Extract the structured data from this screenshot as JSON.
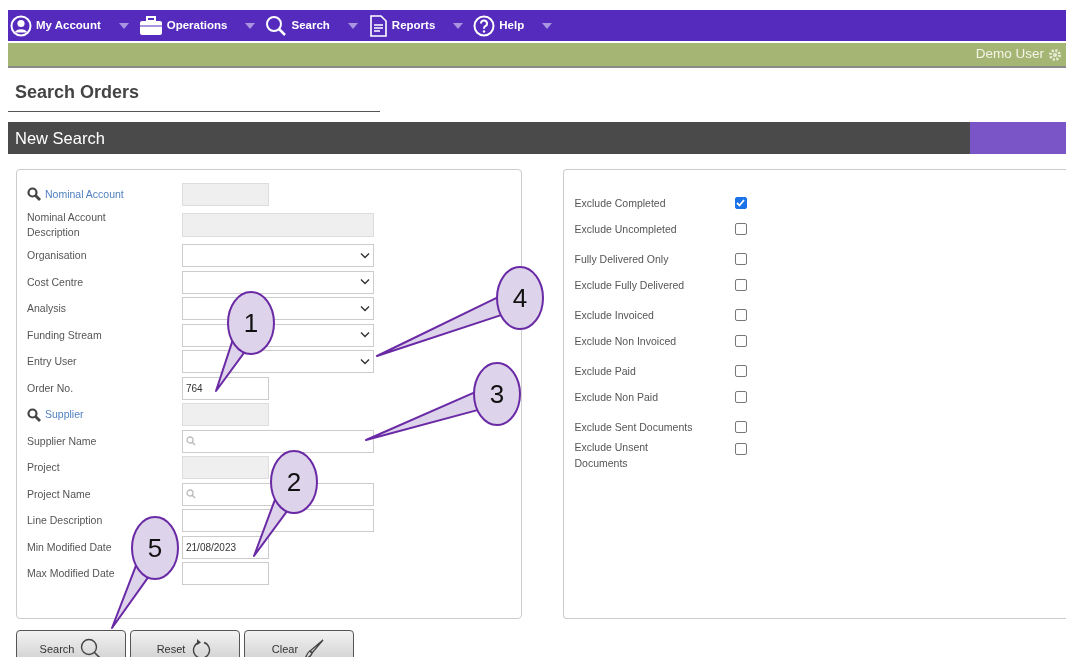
{
  "menu": [
    {
      "label": "My Account"
    },
    {
      "label": "Operations"
    },
    {
      "label": "Search"
    },
    {
      "label": "Reports"
    },
    {
      "label": "Help"
    }
  ],
  "user": {
    "name": "Demo User"
  },
  "page_title": "Search Orders",
  "section_title": "New Search",
  "fields": [
    {
      "label": "Nominal Account",
      "link": true,
      "kind": "lookup"
    },
    {
      "label": "Nominal Account Description",
      "link": false,
      "kind": "display"
    },
    {
      "label": "Organisation",
      "link": false,
      "kind": "select"
    },
    {
      "label": "Cost Centre",
      "link": false,
      "kind": "select"
    },
    {
      "label": "Analysis",
      "link": false,
      "kind": "select"
    },
    {
      "label": "Funding Stream",
      "link": false,
      "kind": "select"
    },
    {
      "label": "Entry User",
      "link": false,
      "kind": "select"
    },
    {
      "label": "Order No.",
      "link": false,
      "kind": "short",
      "value": "764"
    },
    {
      "label": "Supplier",
      "link": true,
      "kind": "lookup"
    },
    {
      "label": "Supplier Name",
      "link": false,
      "kind": "search"
    },
    {
      "label": "Project",
      "link": false,
      "kind": "lookup"
    },
    {
      "label": "Project Name",
      "link": false,
      "kind": "search"
    },
    {
      "label": "Line Description",
      "link": false,
      "kind": "long"
    },
    {
      "label": "Min Modified Date",
      "link": false,
      "kind": "short",
      "value": "21/08/2023"
    },
    {
      "label": "Max Modified Date",
      "link": false,
      "kind": "short"
    }
  ],
  "options": [
    {
      "label": "Exclude Completed",
      "checked": true
    },
    {
      "label": "Exclude Uncompleted",
      "checked": false
    },
    {
      "label": "Fully Delivered Only",
      "checked": false
    },
    {
      "label": "Exclude Fully Delivered",
      "checked": false
    },
    {
      "label": "Exclude Invoiced",
      "checked": false
    },
    {
      "label": "Exclude Non Invoiced",
      "checked": false
    },
    {
      "label": "Exclude Paid",
      "checked": false
    },
    {
      "label": "Exclude Non Paid",
      "checked": false
    },
    {
      "label": "Exclude Sent Documents",
      "checked": false
    },
    {
      "label": "Exclude Unsent Documents",
      "checked": false
    }
  ],
  "buttons": [
    {
      "label": "Search"
    },
    {
      "label": "Reset"
    },
    {
      "label": "Clear"
    }
  ],
  "callouts": [
    {
      "number": "1"
    },
    {
      "number": "2"
    },
    {
      "number": "3"
    },
    {
      "number": "4"
    },
    {
      "number": "5"
    }
  ]
}
